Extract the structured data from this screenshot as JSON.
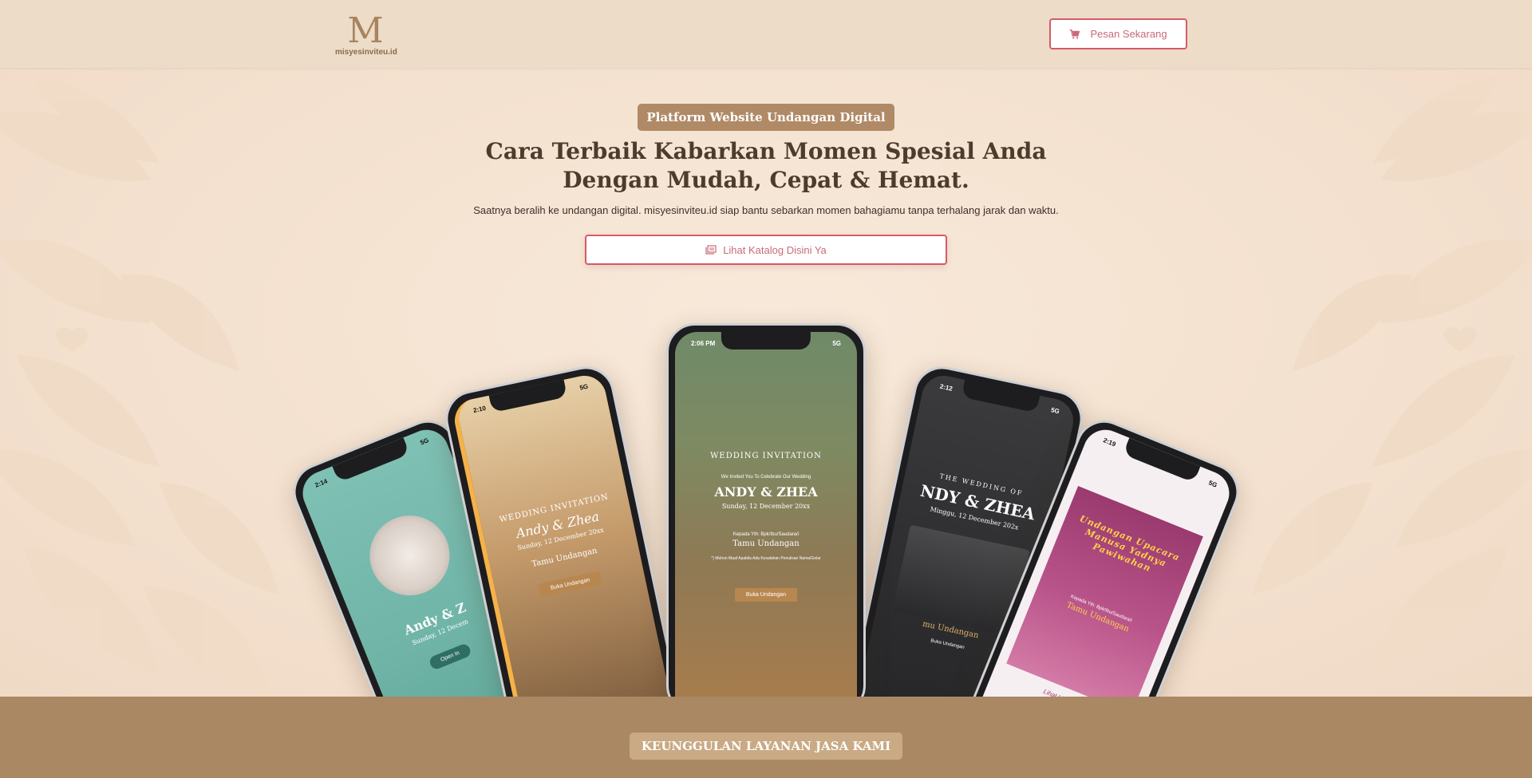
{
  "header": {
    "logo_mark": "M",
    "logo_text": "misyesinviteu.id",
    "order_button": "Pesan Sekarang"
  },
  "hero": {
    "badge": "Platform Website Undangan Digital",
    "headline_line1": "Cara Terbaik Kabarkan Momen Spesial Anda",
    "headline_line2": "Dengan Mudah, Cepat & Hemat.",
    "subtext": "Saatnya beralih ke undangan digital. misyesinviteu.id siap bantu sebarkan momen bahagiamu tanpa terhalang jarak dan waktu.",
    "catalog_button": "Lihat Katalog Disini Ya"
  },
  "phones": [
    {
      "time": "2:14",
      "title": "",
      "names": "Andy & Z",
      "date": "Sunday, 12 Decem",
      "button": "Open In"
    },
    {
      "time": "2:10",
      "title": "WEDDING INVITATION",
      "names": "Andy & Zhea",
      "date": "Sunday, 12 December 20xx",
      "guest": "Tamu Undangan",
      "button": "Buka Undangan"
    },
    {
      "time": "2:06 PM",
      "title": "WEDDING INVITATION",
      "invite_line": "We Invited You To Celebrate Our Wedding",
      "names": "ANDY & ZHEA",
      "date": "Sunday, 12 December 20xx",
      "to_line": "Kepada Yth: Bpk/Ibu/Saudara/i",
      "guest": "Tamu Undangan",
      "note": "*) Mohon Maaf Apabila Ada Kesalahan Penulisan Nama/Gelar",
      "button": "Buka Undangan"
    },
    {
      "time": "2:12",
      "title": "THE WEDDING OF",
      "names": "NDY & ZHEA",
      "date": "Minggu, 12 December 202x",
      "guest": "mu Undangan",
      "button": "Buka Undangan"
    },
    {
      "time": "2:19",
      "title": "Undangan Upacara Manusa Yadnya Pawiwahan",
      "to_line": "Kepada Yth: Bpk/Ibu/Saudara/i",
      "guest": "Tamu Undangan",
      "button": "Lihat Undangan"
    }
  ],
  "section": {
    "badge": "KEUNGGULAN LAYANAN JASA KAMI"
  },
  "colors": {
    "accent_red": "#d65a6a",
    "brand_brown": "#b08a66",
    "band_brown": "#a98863"
  }
}
